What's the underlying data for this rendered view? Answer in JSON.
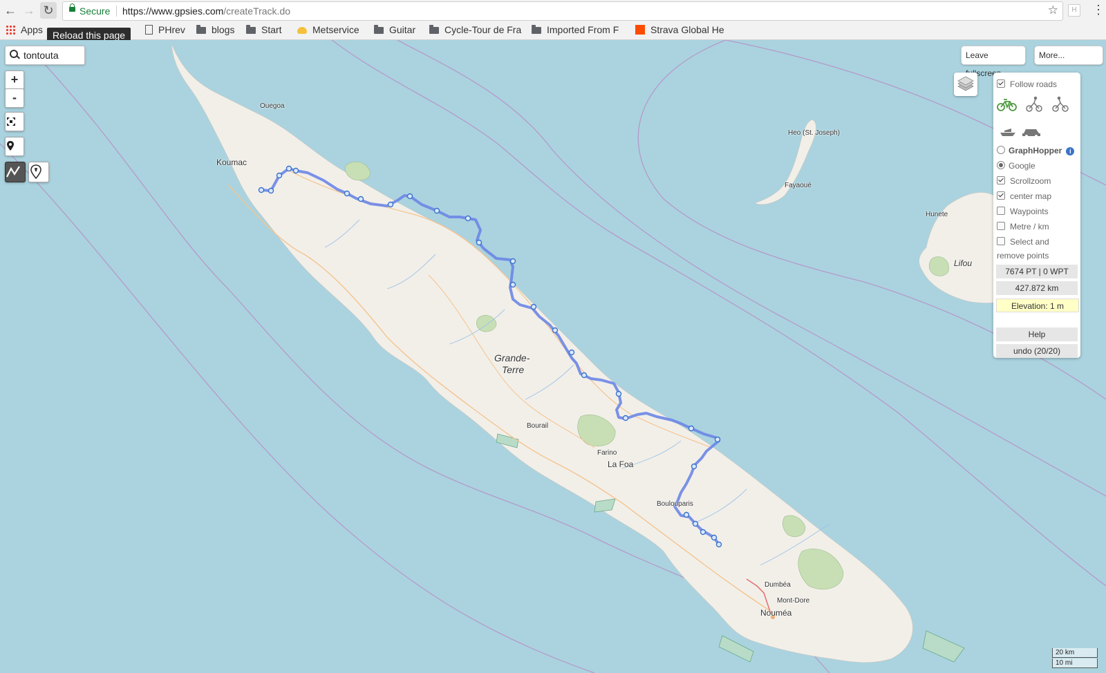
{
  "browser": {
    "secure_label": "Secure",
    "url_host": "https://www.gpsies.com",
    "url_path": "/createTrack.do",
    "extension_letter": "H",
    "tooltip": "Reload this page",
    "bookmarks": [
      {
        "label": "Apps",
        "icon": "apps-grid-icon"
      },
      {
        "label": "PHrev",
        "icon": "page-icon"
      },
      {
        "label": "blogs",
        "icon": "folder-icon"
      },
      {
        "label": "Start",
        "icon": "folder-icon"
      },
      {
        "label": "Metservice",
        "icon": "weather-icon"
      },
      {
        "label": "Guitar",
        "icon": "folder-icon"
      },
      {
        "label": "Cycle-Tour de Fra",
        "icon": "folder-icon"
      },
      {
        "label": "Imported From F",
        "icon": "folder-icon"
      },
      {
        "label": "Strava Global He",
        "icon": "strava-icon"
      }
    ]
  },
  "map": {
    "search": {
      "value": "tontouta"
    },
    "controls": {
      "zoom_in": "+",
      "zoom_out": "-"
    },
    "buttons": {
      "leave_fullscreen": "Leave fullscreen",
      "more": "More..."
    },
    "labels": {
      "ouegoa": "Ouegoa",
      "koumac": "Koumac",
      "heo": "Heo (St. Joseph)",
      "fayaoue": "Fayaoué",
      "hunete": "Hunete",
      "lifou": "Lifou",
      "grande_terre_1": "Grande-",
      "grande_terre_2": "Terre",
      "bourail": "Bourail",
      "farino": "Farino",
      "la_foa": "La Foa",
      "boulouparis": "Boulouparis",
      "dumbea": "Dumbéa",
      "mont_dore": "Mont-Dore",
      "noumea": "Nouméa"
    },
    "scale": {
      "km": "20 km",
      "mi": "10 mi"
    }
  },
  "panel": {
    "follow_roads": "Follow roads",
    "graphhopper": "GraphHopper",
    "google": "Google",
    "scrollzoom": "Scrollzoom",
    "center_map": "center map",
    "waypoints": "Waypoints",
    "metre_km": "Metre / km",
    "select_remove_1": "Select and",
    "select_remove_2": "remove points",
    "points": "7674 PT | 0 WPT",
    "distance": "427.872 km",
    "elevation": "Elevation: 1 m",
    "help": "Help",
    "undo": "undo (20/20)",
    "router_selected": "Google",
    "checked": {
      "follow_roads": true,
      "scrollzoom": true,
      "center_map": true,
      "waypoints": false,
      "metre_km": false,
      "select_remove": false
    }
  },
  "colors": {
    "water": "#aad3df",
    "land": "#f2efe9",
    "track": "#6c86e6",
    "forest": "#c8dfb6"
  }
}
